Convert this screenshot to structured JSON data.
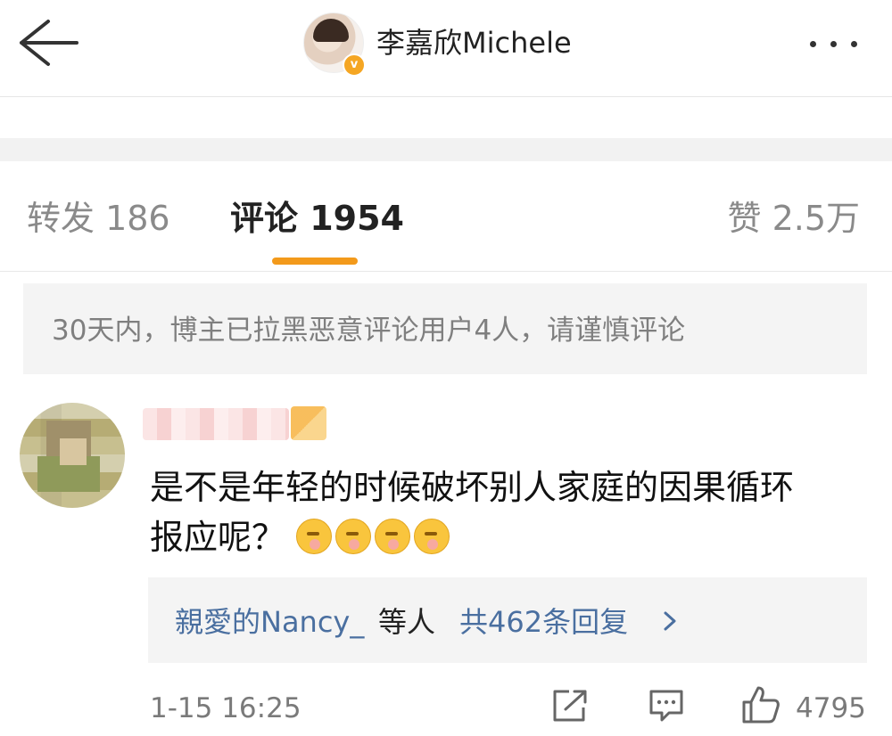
{
  "header": {
    "title": "李嘉欣Michele",
    "verified_badge": "v"
  },
  "tabs": [
    {
      "label": "转发 186"
    },
    {
      "label": "评论 1954"
    },
    {
      "label": "赞 2.5万"
    }
  ],
  "notice": "30天内，博主已拉黑恶意评论用户4人，请谨慎评论",
  "comment": {
    "text_line1": "是不是年轻的时候破坏别人家庭的因果循环",
    "text_line2": "报应呢？",
    "emoji_count": 4,
    "replies": {
      "names": "親愛的Nancy_",
      "suffix": "等人",
      "count": "共462条回复"
    },
    "time": "1-15 16:25",
    "likes": "4795"
  },
  "colors": {
    "accent": "#f39a1b",
    "link": "#4a6fa0",
    "muted": "#8a8a8a"
  },
  "icons": [
    "back-arrow-icon",
    "more-icon",
    "verified-icon",
    "chevron-right-icon",
    "share-icon",
    "comment-icon",
    "like-icon"
  ]
}
